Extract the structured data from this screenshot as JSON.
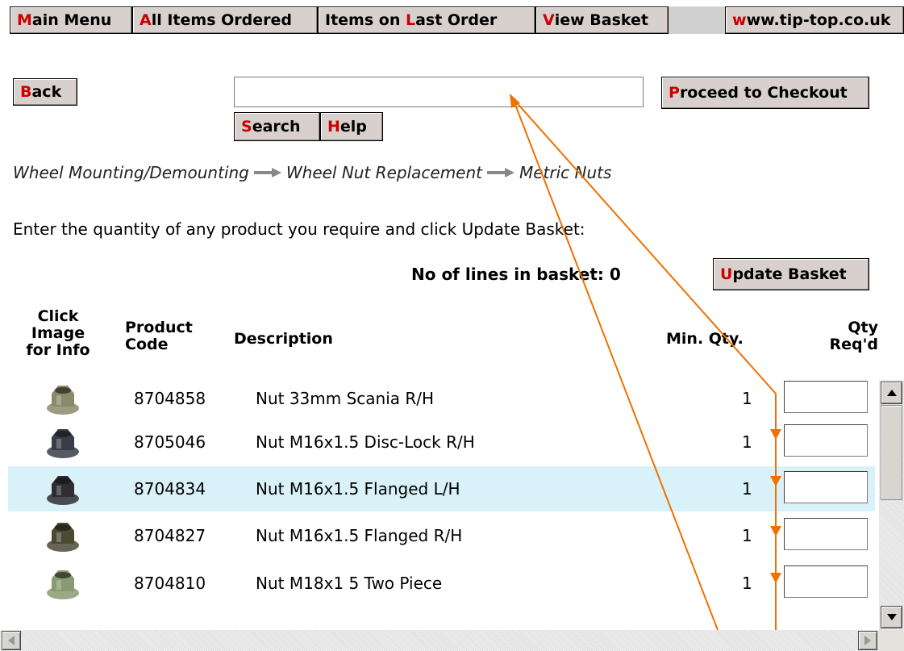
{
  "nav": {
    "main_menu": {
      "hk": "M",
      "rest": "ain Menu"
    },
    "all_items": {
      "hk": "A",
      "rest": "ll Items Ordered"
    },
    "last_order": {
      "pre": "Items on ",
      "hk": "L",
      "rest": "ast Order"
    },
    "view_basket": {
      "hk": "V",
      "rest": "iew Basket"
    },
    "site": {
      "hk": "w",
      "rest": "ww.tip-top.co.uk"
    }
  },
  "toolbar": {
    "back": {
      "hk": "B",
      "rest": "ack"
    },
    "search": {
      "hk": "S",
      "rest": "earch"
    },
    "help": {
      "hk": "H",
      "rest": "elp"
    },
    "checkout": {
      "hk": "P",
      "rest": "roceed to Checkout"
    },
    "search_value": ""
  },
  "breadcrumb": [
    "Wheel Mounting/Demounting",
    "Wheel Nut Replacement",
    "Metric Nuts"
  ],
  "instruction": "Enter the quantity of any product you require and click Update Basket:",
  "basket_count": "No of lines in basket: 0",
  "update_basket": {
    "hk": "U",
    "rest": "pdate Basket"
  },
  "table": {
    "headers": {
      "image": [
        "Click",
        "Image",
        "for Info"
      ],
      "code": [
        "Product",
        "Code"
      ],
      "description": "Description",
      "min_qty": "Min. Qty.",
      "qty_reqd": [
        "Qty",
        "Req'd"
      ]
    },
    "rows": [
      {
        "code": "8704858",
        "description": "Nut 33mm Scania R/H",
        "min_qty": "1",
        "qty": "",
        "color": "#8a8a6a"
      },
      {
        "code": "8705046",
        "description": "Nut M16x1.5 Disc-Lock R/H",
        "min_qty": "1",
        "qty": "",
        "color": "#3a3c48"
      },
      {
        "code": "8704834",
        "description": "Nut M16x1.5 Flanged L/H",
        "min_qty": "1",
        "qty": "",
        "color": "#2e2e32"
      },
      {
        "code": "8704827",
        "description": "Nut M16x1.5 Flanged R/H",
        "min_qty": "1",
        "qty": "",
        "color": "#4a4a32"
      },
      {
        "code": "8704810",
        "description": "Nut M18x1 5 Two Piece",
        "min_qty": "1",
        "qty": "",
        "color": "#8a9a72"
      }
    ]
  },
  "colors": {
    "hotkey": "#cc0000",
    "button_bg": "#d8d0cc",
    "highlight_row": "#d9f1f8",
    "annotation": "#f07000"
  }
}
